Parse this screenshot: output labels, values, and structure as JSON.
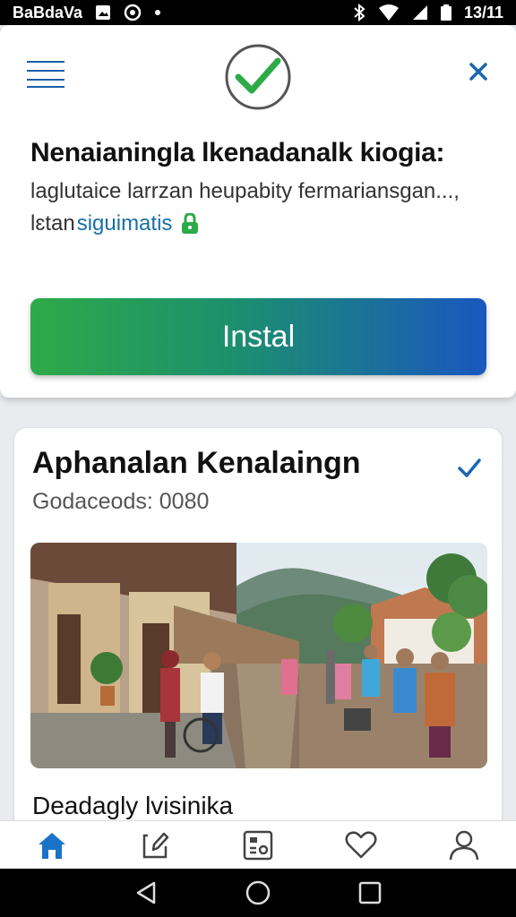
{
  "status_bar": {
    "left_text": "BaBdaVa",
    "time": "13/11",
    "icons": [
      "image-icon",
      "circle-dot-icon",
      "bluetooth-icon",
      "wifi-icon",
      "signal-icon",
      "battery-icon"
    ]
  },
  "install_sheet": {
    "title": "Nenaianingla lkenadanalk kiogia:",
    "description": "laglutaice larrzan heupabity fermariansgan...,",
    "description2_prefix": "lɛtan",
    "description2_link": "siguimatis",
    "install_label": "Instal",
    "colors": {
      "gradient_start": "#2eaa48",
      "gradient_end": "#1a57c0",
      "accent": "#1a66b0"
    }
  },
  "card": {
    "title": "Aphanalan Kenalaingn",
    "meta": "Godaceods: 0080",
    "caption": "Deadagly lvisinika"
  },
  "bottom_nav": {
    "items": [
      "home-icon",
      "edit-icon",
      "id-card-icon",
      "heart-icon",
      "profile-icon"
    ],
    "active": "home-icon",
    "active_color": "#1a73c8"
  },
  "system_nav": [
    "back-icon",
    "home-circle-icon",
    "recents-icon"
  ]
}
